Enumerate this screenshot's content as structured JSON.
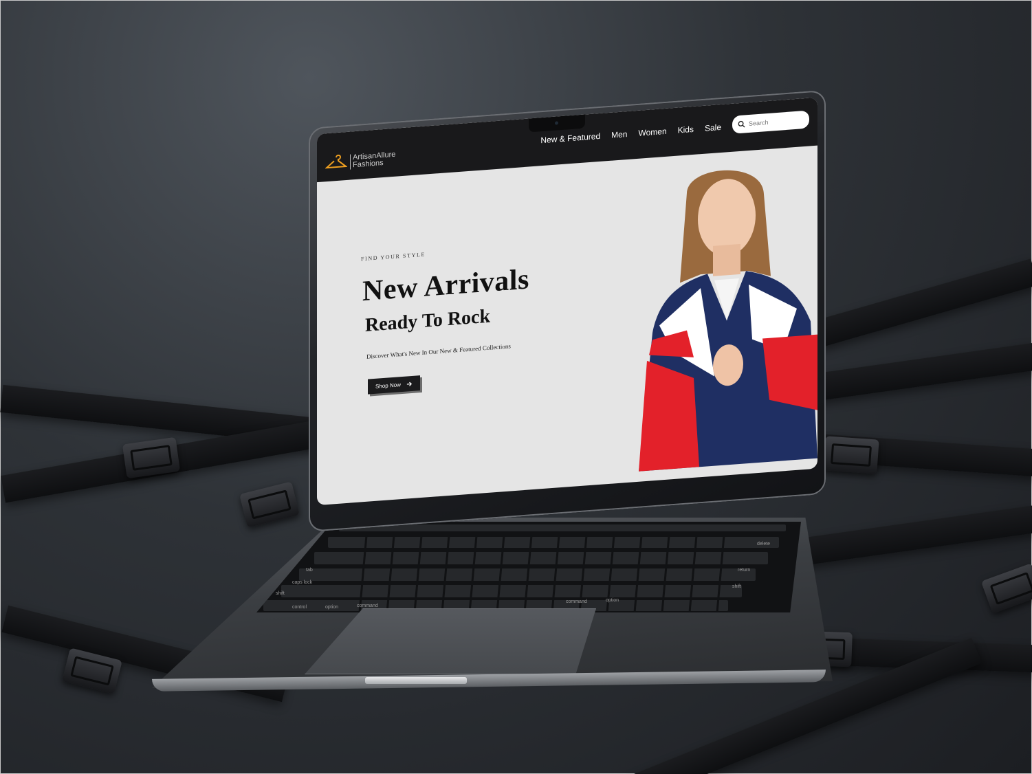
{
  "site": {
    "brand_line1": "ArtisanAllure",
    "brand_line2": "Fashions",
    "nav": [
      {
        "label": "New & Featured"
      },
      {
        "label": "Men"
      },
      {
        "label": "Women"
      },
      {
        "label": "Kids"
      },
      {
        "label": "Sale"
      }
    ],
    "search_placeholder": "Search"
  },
  "hero": {
    "eyebrow": "FIND YOUR STYLE",
    "title": "New Arrivals",
    "subtitle": "Ready To Rock",
    "description": "Discover What's New In Our New & Featured Collections",
    "cta": "Shop Now"
  },
  "keyboard_labels": {
    "delete": "delete",
    "tab": "tab",
    "return": "return",
    "caps": "caps lock",
    "shift_left": "shift",
    "shift_right": "shift",
    "control": "control",
    "option_left": "option",
    "command_left": "command",
    "command_right": "command",
    "option_right": "option"
  },
  "colors": {
    "background": "#2e3237",
    "nav_bg": "#19191b",
    "hero_bg": "#e5e5e5",
    "logo_accent": "#f0a020",
    "jacket_navy": "#1f2f63",
    "jacket_red": "#e3212a"
  }
}
